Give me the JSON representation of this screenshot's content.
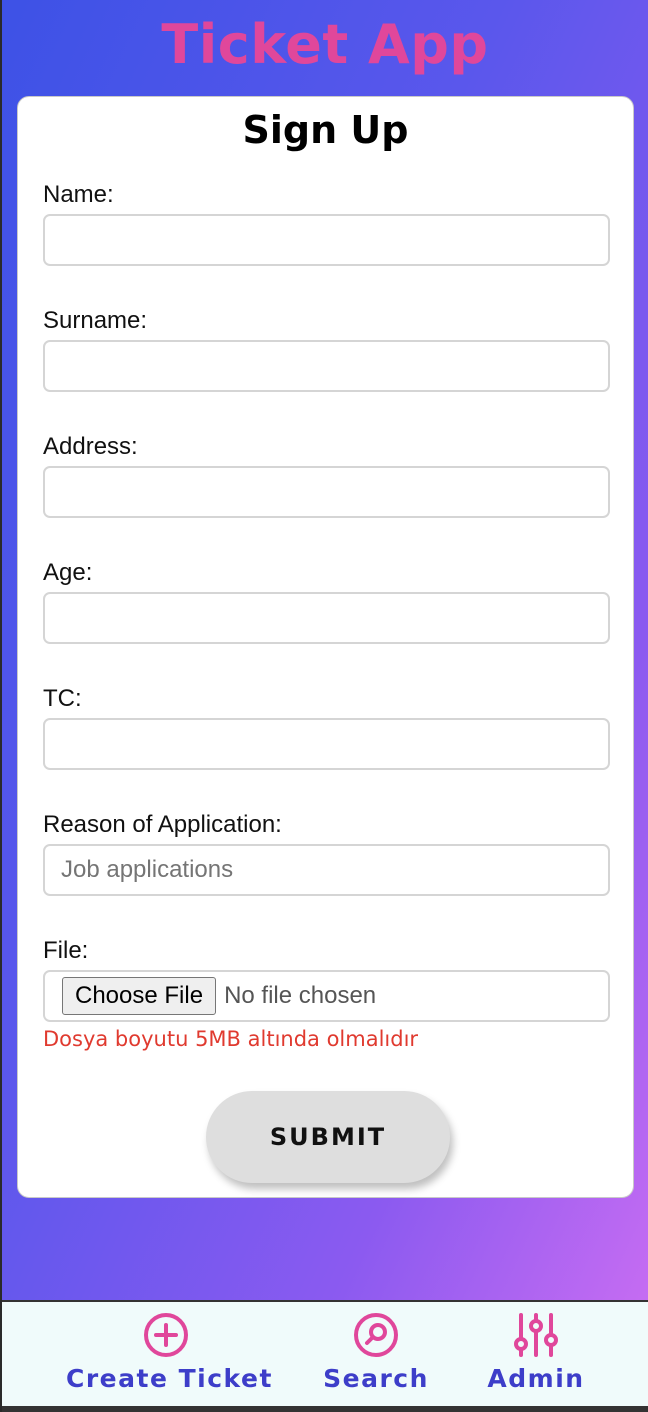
{
  "app": {
    "title": "Ticket App"
  },
  "form": {
    "title": "Sign Up",
    "fields": [
      {
        "label": "Name:",
        "value": "",
        "placeholder": ""
      },
      {
        "label": "Surname:",
        "value": "",
        "placeholder": ""
      },
      {
        "label": "Address:",
        "value": "",
        "placeholder": ""
      },
      {
        "label": "Age:",
        "value": "",
        "placeholder": ""
      },
      {
        "label": "TC:",
        "value": "",
        "placeholder": ""
      },
      {
        "label": "Reason of Application:",
        "value": "",
        "placeholder": "Job applications"
      }
    ],
    "file": {
      "label": "File:",
      "button_label": "Choose File",
      "status": "No file chosen",
      "hint": "Dosya boyutu 5MB altında olmalıdır"
    },
    "submit_label": "SUBMIT"
  },
  "nav": {
    "items": [
      {
        "label": "Create Ticket",
        "icon": "plus-circle-icon"
      },
      {
        "label": "Search",
        "icon": "search-circle-icon"
      },
      {
        "label": "Admin",
        "icon": "sliders-icon"
      }
    ]
  },
  "colors": {
    "brand_pink": "#e0479b",
    "nav_text": "#3d3ec9",
    "error_text": "#e03a2f",
    "gradient_start": "#3d52e6",
    "gradient_end": "#c56cf2",
    "nav_background": "#f0fbfb"
  }
}
